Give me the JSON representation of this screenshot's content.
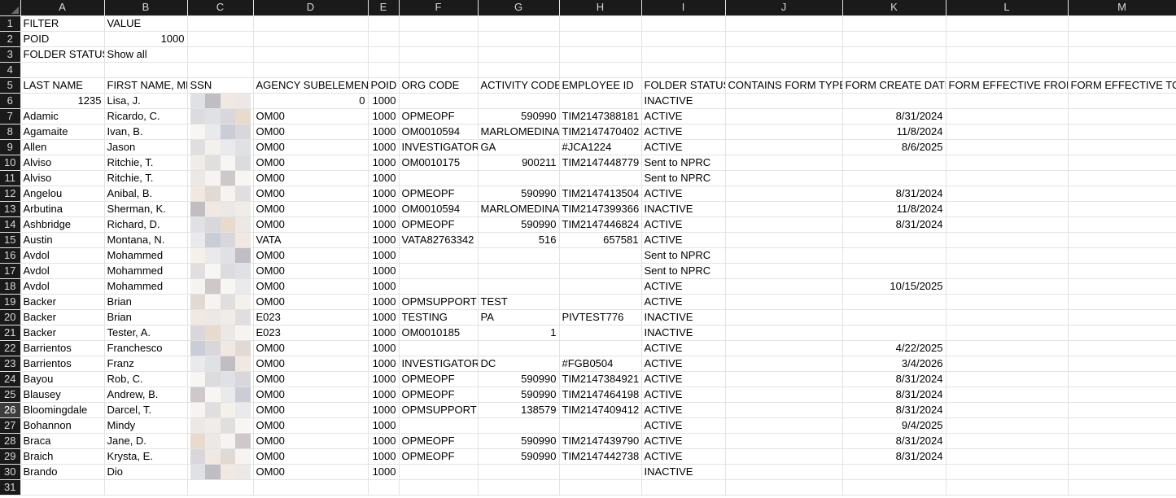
{
  "columns": [
    "A",
    "B",
    "C",
    "D",
    "E",
    "F",
    "G",
    "H",
    "I",
    "J",
    "K",
    "L",
    "M"
  ],
  "rows": [
    {
      "n": "1",
      "A": "FILTER",
      "B": "VALUE",
      "C": "",
      "D": "",
      "E": "",
      "F": "",
      "G": "",
      "H": "",
      "I": "",
      "J": "",
      "K": "",
      "L": "",
      "M": ""
    },
    {
      "n": "2",
      "A": "POID",
      "B": "1000",
      "C": "",
      "D": "",
      "E": "",
      "F": "",
      "G": "",
      "H": "",
      "I": "",
      "J": "",
      "K": "",
      "L": "",
      "M": ""
    },
    {
      "n": "3",
      "A": "FOLDER STATUS",
      "B": "Show all",
      "C": "",
      "D": "",
      "E": "",
      "F": "",
      "G": "",
      "H": "",
      "I": "",
      "J": "",
      "K": "",
      "L": "",
      "M": ""
    },
    {
      "n": "4",
      "A": "",
      "B": "",
      "C": "",
      "D": "",
      "E": "",
      "F": "",
      "G": "",
      "H": "",
      "I": "",
      "J": "",
      "K": "",
      "L": "",
      "M": ""
    },
    {
      "n": "5",
      "A": "LAST NAME",
      "B": "FIRST NAME, MI",
      "C": "SSN",
      "D": "AGENCY SUBELEMENT",
      "E": "POID",
      "F": "ORG CODE",
      "G": "ACTIVITY CODE",
      "H": "EMPLOYEE ID",
      "I": "FOLDER STATUS",
      "J": "CONTAINS FORM TYPE",
      "K": "FORM CREATE DATE",
      "L": "FORM EFFECTIVE FROM",
      "M": "FORM EFFECTIVE TO"
    },
    {
      "n": "6",
      "A": "1235",
      "B": "Lisa, J.",
      "C": "",
      "D": "0",
      "E": "1000",
      "F": "",
      "G": "",
      "H": "",
      "I": "INACTIVE",
      "J": "",
      "K": "",
      "L": "",
      "M": ""
    },
    {
      "n": "7",
      "A": "Adamic",
      "B": "Ricardo, C.",
      "C": "",
      "D": "OM00",
      "E": "1000",
      "F": "OPMEOPF",
      "G": "590990",
      "H": "TIM2147388181",
      "I": "ACTIVE",
      "J": "",
      "K": "8/31/2024",
      "L": "",
      "M": ""
    },
    {
      "n": "8",
      "A": "Agamaite",
      "B": "Ivan, B.",
      "C": "",
      "D": "OM00",
      "E": "1000",
      "F": "OM0010594",
      "G": "MARLOMEDINA",
      "H": "TIM2147470402",
      "I": "ACTIVE",
      "J": "",
      "K": "11/8/2024",
      "L": "",
      "M": ""
    },
    {
      "n": "9",
      "A": "Allen",
      "B": "Jason",
      "C": "",
      "D": "OM00",
      "E": "1000",
      "F": "INVESTIGATOR",
      "G": "GA",
      "H": "#JCA1224",
      "I": "ACTIVE",
      "J": "",
      "K": "8/6/2025",
      "L": "",
      "M": ""
    },
    {
      "n": "10",
      "A": "Alviso",
      "B": "Ritchie, T.",
      "C": "",
      "D": "OM00",
      "E": "1000",
      "F": "OM0010175",
      "G": "900211",
      "H": "TIM2147448779",
      "I": "Sent to NPRC",
      "J": "",
      "K": "",
      "L": "",
      "M": ""
    },
    {
      "n": "11",
      "A": "Alviso",
      "B": "Ritchie, T.",
      "C": "",
      "D": "OM00",
      "E": "1000",
      "F": "",
      "G": "",
      "H": "",
      "I": "Sent to NPRC",
      "J": "",
      "K": "",
      "L": "",
      "M": ""
    },
    {
      "n": "12",
      "A": "Angelou",
      "B": "Anibal, B.",
      "C": "",
      "D": "OM00",
      "E": "1000",
      "F": "OPMEOPF",
      "G": "590990",
      "H": "TIM2147413504",
      "I": "ACTIVE",
      "J": "",
      "K": "8/31/2024",
      "L": "",
      "M": ""
    },
    {
      "n": "13",
      "A": "Arbutina",
      "B": "Sherman, K.",
      "C": "",
      "D": "OM00",
      "E": "1000",
      "F": "OM0010594",
      "G": "MARLOMEDINA",
      "H": "TIM2147399366",
      "I": "INACTIVE",
      "J": "",
      "K": "11/8/2024",
      "L": "",
      "M": ""
    },
    {
      "n": "14",
      "A": "Ashbridge",
      "B": "Richard, D.",
      "C": "",
      "D": "OM00",
      "E": "1000",
      "F": "OPMEOPF",
      "G": "590990",
      "H": "TIM2147446824",
      "I": "ACTIVE",
      "J": "",
      "K": "8/31/2024",
      "L": "",
      "M": ""
    },
    {
      "n": "15",
      "A": "Austin",
      "B": "Montana, N.",
      "C": "",
      "D": "VATA",
      "E": "1000",
      "F": "VATA82763342",
      "G": "516",
      "H": "657581",
      "I": "ACTIVE",
      "J": "",
      "K": "",
      "L": "",
      "M": ""
    },
    {
      "n": "16",
      "A": "Avdol",
      "B": "Mohammed",
      "C": "",
      "D": "OM00",
      "E": "1000",
      "F": "",
      "G": "",
      "H": "",
      "I": "Sent to NPRC",
      "J": "",
      "K": "",
      "L": "",
      "M": ""
    },
    {
      "n": "17",
      "A": "Avdol",
      "B": "Mohammed",
      "C": "",
      "D": "OM00",
      "E": "1000",
      "F": "",
      "G": "",
      "H": "",
      "I": "Sent to NPRC",
      "J": "",
      "K": "",
      "L": "",
      "M": ""
    },
    {
      "n": "18",
      "A": "Avdol",
      "B": "Mohammed",
      "C": "",
      "D": "OM00",
      "E": "1000",
      "F": "",
      "G": "",
      "H": "",
      "I": "ACTIVE",
      "J": "",
      "K": "10/15/2025",
      "L": "",
      "M": ""
    },
    {
      "n": "19",
      "A": "Backer",
      "B": "Brian",
      "C": "",
      "D": "OM00",
      "E": "1000",
      "F": "OPMSUPPORT",
      "G": "TEST",
      "H": "",
      "I": "ACTIVE",
      "J": "",
      "K": "",
      "L": "",
      "M": ""
    },
    {
      "n": "20",
      "A": "Backer",
      "B": "Brian",
      "C": "",
      "D": "E023",
      "E": "1000",
      "F": "TESTING",
      "G": "PA",
      "H": "PIVTEST776",
      "I": "INACTIVE",
      "J": "",
      "K": "",
      "L": "",
      "M": ""
    },
    {
      "n": "21",
      "A": "Backer",
      "B": "Tester, A.",
      "C": "",
      "D": "E023",
      "E": "1000",
      "F": "OM0010185",
      "G": "1",
      "H": "",
      "I": "INACTIVE",
      "J": "",
      "K": "",
      "L": "",
      "M": ""
    },
    {
      "n": "22",
      "A": "Barrientos",
      "B": "Franchesco",
      "C": "",
      "D": "OM00",
      "E": "1000",
      "F": "",
      "G": "",
      "H": "",
      "I": "ACTIVE",
      "J": "",
      "K": "4/22/2025",
      "L": "",
      "M": ""
    },
    {
      "n": "23",
      "A": "Barrientos",
      "B": "Franz",
      "C": "",
      "D": "OM00",
      "E": "1000",
      "F": "INVESTIGATOR",
      "G": "DC",
      "H": "#FGB0504",
      "I": "ACTIVE",
      "J": "",
      "K": "3/4/2026",
      "L": "",
      "M": ""
    },
    {
      "n": "24",
      "A": "Bayou",
      "B": "Rob, C.",
      "C": "",
      "D": "OM00",
      "E": "1000",
      "F": "OPMEOPF",
      "G": "590990",
      "H": "TIM2147384921",
      "I": "ACTIVE",
      "J": "",
      "K": "8/31/2024",
      "L": "",
      "M": ""
    },
    {
      "n": "25",
      "A": "Blausey",
      "B": "Andrew, B.",
      "C": "",
      "D": "OM00",
      "E": "1000",
      "F": "OPMEOPF",
      "G": "590990",
      "H": "TIM2147464198",
      "I": "ACTIVE",
      "J": "",
      "K": "8/31/2024",
      "L": "",
      "M": ""
    },
    {
      "n": "26",
      "A": "Bloomingdale",
      "B": "Darcel, T.",
      "C": "",
      "D": "OM00",
      "E": "1000",
      "F": "OPMSUPPORT",
      "G": "138579",
      "H": "TIM2147409412",
      "I": "ACTIVE",
      "J": "",
      "K": "8/31/2024",
      "L": "",
      "M": ""
    },
    {
      "n": "27",
      "A": "Bohannon",
      "B": "Mindy",
      "C": "",
      "D": "OM00",
      "E": "1000",
      "F": "",
      "G": "",
      "H": "",
      "I": "ACTIVE",
      "J": "",
      "K": "9/4/2025",
      "L": "",
      "M": ""
    },
    {
      "n": "28",
      "A": "Braca",
      "B": "Jane, D.",
      "C": "",
      "D": "OM00",
      "E": "1000",
      "F": "OPMEOPF",
      "G": "590990",
      "H": "TIM2147439790",
      "I": "ACTIVE",
      "J": "",
      "K": "8/31/2024",
      "L": "",
      "M": ""
    },
    {
      "n": "29",
      "A": "Braich",
      "B": "Krysta, E.",
      "C": "",
      "D": "OM00",
      "E": "1000",
      "F": "OPMEOPF",
      "G": "590990",
      "H": "TIM2147442738",
      "I": "ACTIVE",
      "J": "",
      "K": "8/31/2024",
      "L": "",
      "M": ""
    },
    {
      "n": "30",
      "A": "Brando",
      "B": "Dio",
      "C": "",
      "D": "OM00",
      "E": "1000",
      "F": "",
      "G": "",
      "H": "",
      "I": "INACTIVE",
      "J": "",
      "K": "",
      "L": "",
      "M": ""
    },
    {
      "n": "31",
      "A": "",
      "B": "",
      "C": "",
      "D": "",
      "E": "",
      "F": "",
      "G": "",
      "H": "",
      "I": "",
      "J": "",
      "K": "",
      "L": "",
      "M": ""
    }
  ],
  "selected_row": "26",
  "ssn_mask_colors": [
    "#c9c2c4",
    "#e6d6c8",
    "#d8d8dc",
    "#eeeae6",
    "#b9b6bd",
    "#f3efe9",
    "#ddd5cf",
    "#c4c8d0"
  ]
}
